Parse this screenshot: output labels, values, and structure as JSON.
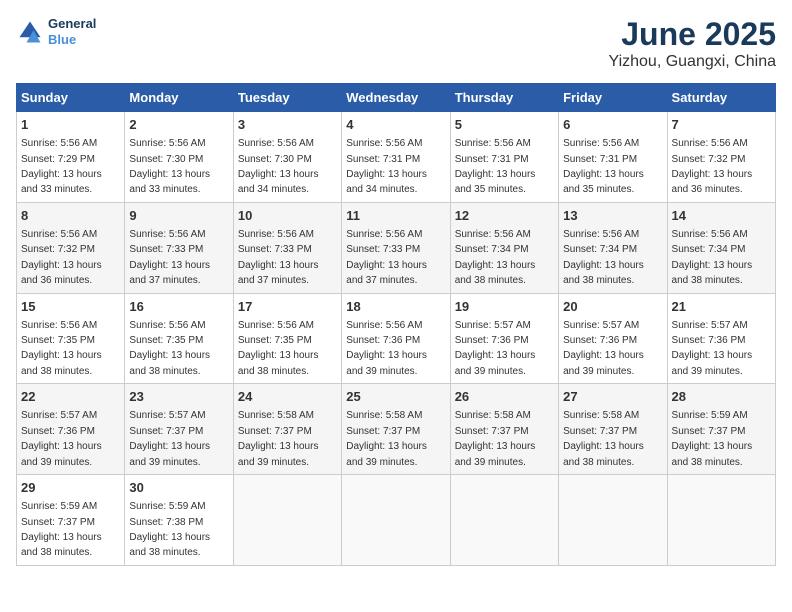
{
  "header": {
    "logo_line1": "General",
    "logo_line2": "Blue",
    "title": "June 2025",
    "subtitle": "Yizhou, Guangxi, China"
  },
  "calendar": {
    "weekdays": [
      "Sunday",
      "Monday",
      "Tuesday",
      "Wednesday",
      "Thursday",
      "Friday",
      "Saturday"
    ],
    "weeks": [
      [
        null,
        null,
        null,
        null,
        null,
        null,
        null
      ]
    ],
    "days": [
      {
        "date": 1,
        "dow": 0,
        "sunrise": "5:56 AM",
        "sunset": "7:29 PM",
        "daylight": "13 hours and 33 minutes."
      },
      {
        "date": 2,
        "dow": 1,
        "sunrise": "5:56 AM",
        "sunset": "7:30 PM",
        "daylight": "13 hours and 33 minutes."
      },
      {
        "date": 3,
        "dow": 2,
        "sunrise": "5:56 AM",
        "sunset": "7:30 PM",
        "daylight": "13 hours and 34 minutes."
      },
      {
        "date": 4,
        "dow": 3,
        "sunrise": "5:56 AM",
        "sunset": "7:31 PM",
        "daylight": "13 hours and 34 minutes."
      },
      {
        "date": 5,
        "dow": 4,
        "sunrise": "5:56 AM",
        "sunset": "7:31 PM",
        "daylight": "13 hours and 35 minutes."
      },
      {
        "date": 6,
        "dow": 5,
        "sunrise": "5:56 AM",
        "sunset": "7:31 PM",
        "daylight": "13 hours and 35 minutes."
      },
      {
        "date": 7,
        "dow": 6,
        "sunrise": "5:56 AM",
        "sunset": "7:32 PM",
        "daylight": "13 hours and 36 minutes."
      },
      {
        "date": 8,
        "dow": 0,
        "sunrise": "5:56 AM",
        "sunset": "7:32 PM",
        "daylight": "13 hours and 36 minutes."
      },
      {
        "date": 9,
        "dow": 1,
        "sunrise": "5:56 AM",
        "sunset": "7:33 PM",
        "daylight": "13 hours and 37 minutes."
      },
      {
        "date": 10,
        "dow": 2,
        "sunrise": "5:56 AM",
        "sunset": "7:33 PM",
        "daylight": "13 hours and 37 minutes."
      },
      {
        "date": 11,
        "dow": 3,
        "sunrise": "5:56 AM",
        "sunset": "7:33 PM",
        "daylight": "13 hours and 37 minutes."
      },
      {
        "date": 12,
        "dow": 4,
        "sunrise": "5:56 AM",
        "sunset": "7:34 PM",
        "daylight": "13 hours and 38 minutes."
      },
      {
        "date": 13,
        "dow": 5,
        "sunrise": "5:56 AM",
        "sunset": "7:34 PM",
        "daylight": "13 hours and 38 minutes."
      },
      {
        "date": 14,
        "dow": 6,
        "sunrise": "5:56 AM",
        "sunset": "7:34 PM",
        "daylight": "13 hours and 38 minutes."
      },
      {
        "date": 15,
        "dow": 0,
        "sunrise": "5:56 AM",
        "sunset": "7:35 PM",
        "daylight": "13 hours and 38 minutes."
      },
      {
        "date": 16,
        "dow": 1,
        "sunrise": "5:56 AM",
        "sunset": "7:35 PM",
        "daylight": "13 hours and 38 minutes."
      },
      {
        "date": 17,
        "dow": 2,
        "sunrise": "5:56 AM",
        "sunset": "7:35 PM",
        "daylight": "13 hours and 38 minutes."
      },
      {
        "date": 18,
        "dow": 3,
        "sunrise": "5:56 AM",
        "sunset": "7:36 PM",
        "daylight": "13 hours and 39 minutes."
      },
      {
        "date": 19,
        "dow": 4,
        "sunrise": "5:57 AM",
        "sunset": "7:36 PM",
        "daylight": "13 hours and 39 minutes."
      },
      {
        "date": 20,
        "dow": 5,
        "sunrise": "5:57 AM",
        "sunset": "7:36 PM",
        "daylight": "13 hours and 39 minutes."
      },
      {
        "date": 21,
        "dow": 6,
        "sunrise": "5:57 AM",
        "sunset": "7:36 PM",
        "daylight": "13 hours and 39 minutes."
      },
      {
        "date": 22,
        "dow": 0,
        "sunrise": "5:57 AM",
        "sunset": "7:36 PM",
        "daylight": "13 hours and 39 minutes."
      },
      {
        "date": 23,
        "dow": 1,
        "sunrise": "5:57 AM",
        "sunset": "7:37 PM",
        "daylight": "13 hours and 39 minutes."
      },
      {
        "date": 24,
        "dow": 2,
        "sunrise": "5:58 AM",
        "sunset": "7:37 PM",
        "daylight": "13 hours and 39 minutes."
      },
      {
        "date": 25,
        "dow": 3,
        "sunrise": "5:58 AM",
        "sunset": "7:37 PM",
        "daylight": "13 hours and 39 minutes."
      },
      {
        "date": 26,
        "dow": 4,
        "sunrise": "5:58 AM",
        "sunset": "7:37 PM",
        "daylight": "13 hours and 39 minutes."
      },
      {
        "date": 27,
        "dow": 5,
        "sunrise": "5:58 AM",
        "sunset": "7:37 PM",
        "daylight": "13 hours and 38 minutes."
      },
      {
        "date": 28,
        "dow": 6,
        "sunrise": "5:59 AM",
        "sunset": "7:37 PM",
        "daylight": "13 hours and 38 minutes."
      },
      {
        "date": 29,
        "dow": 0,
        "sunrise": "5:59 AM",
        "sunset": "7:37 PM",
        "daylight": "13 hours and 38 minutes."
      },
      {
        "date": 30,
        "dow": 1,
        "sunrise": "5:59 AM",
        "sunset": "7:38 PM",
        "daylight": "13 hours and 38 minutes."
      }
    ],
    "start_dow": 0
  }
}
